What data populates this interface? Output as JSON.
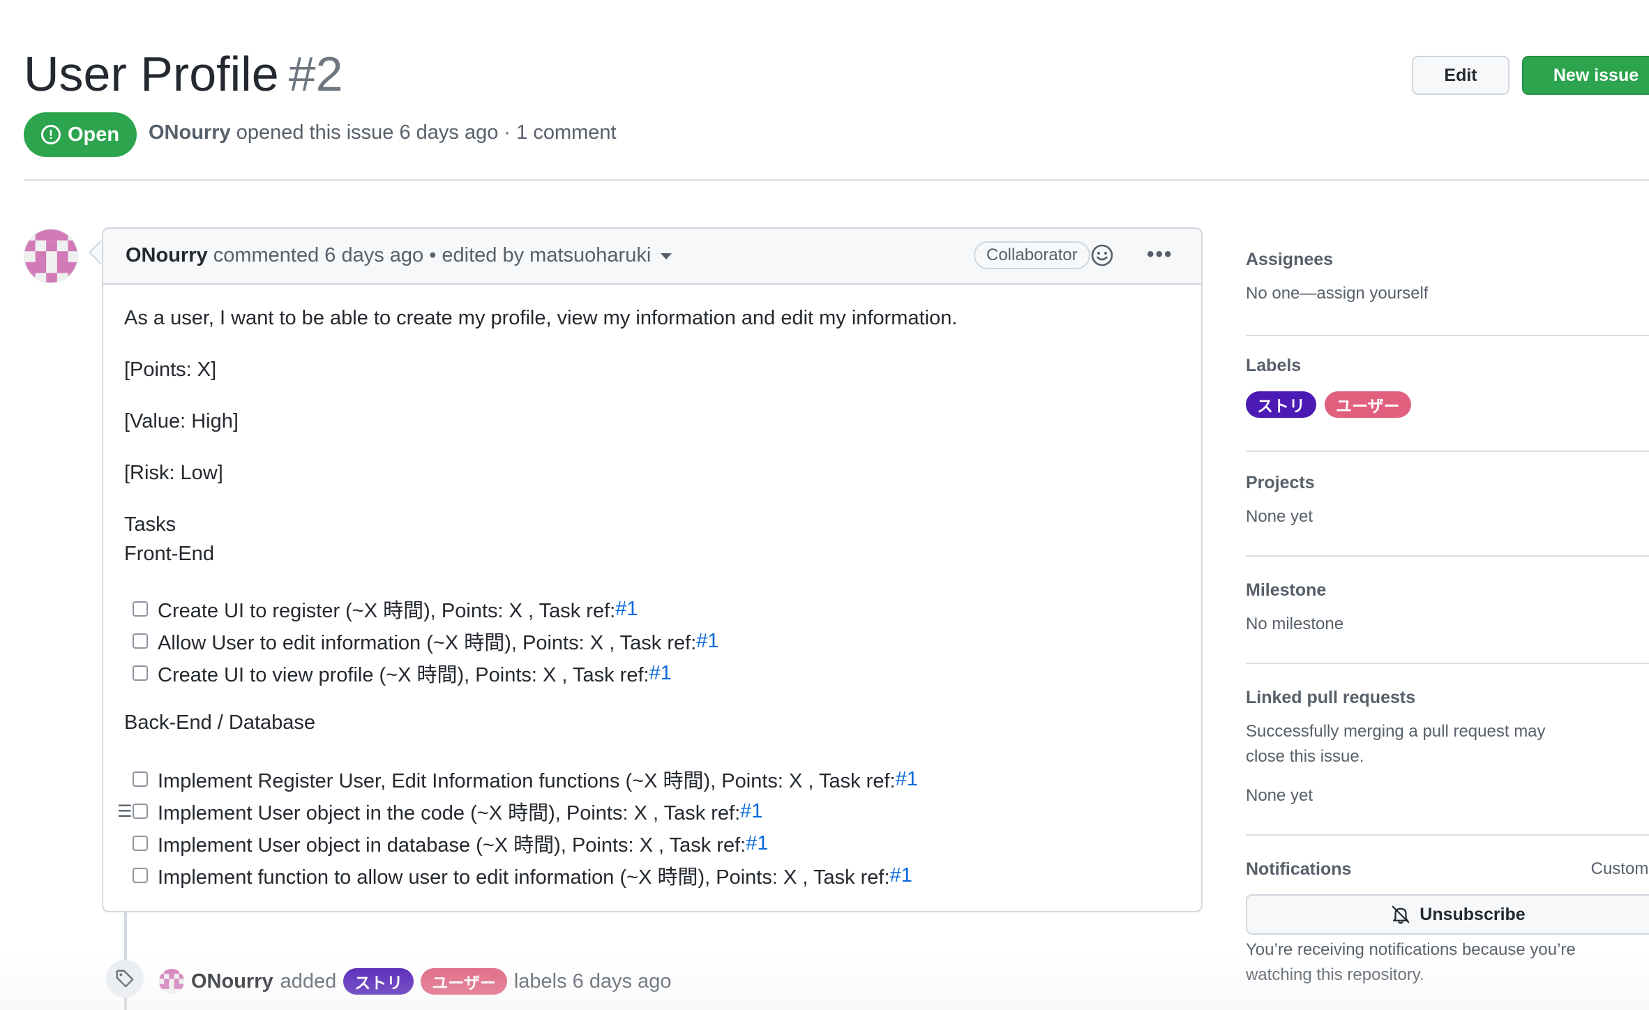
{
  "issue": {
    "title": "User Profile",
    "number": "#2",
    "state": "Open",
    "author": "ONourry",
    "meta_text": "opened this issue 6 days ago · 1 comment"
  },
  "header_buttons": {
    "edit": "Edit",
    "new_issue": "New issue"
  },
  "comment": {
    "author": "ONourry",
    "header_text": "commented 6 days ago • edited by matsuoharuki",
    "role_badge": "Collaborator",
    "body": {
      "intro": "As a user, I want to be able to create my profile, view my information and edit my information.",
      "points": "[Points: X]",
      "value": "[Value: High]",
      "risk": "[Risk: Low]",
      "tasks_heading": "Tasks",
      "frontend_heading": "Front-End",
      "frontend_tasks": [
        {
          "text": "Create UI to register (~X 時間), Points: X , Task ref: ",
          "ref": "#1"
        },
        {
          "text": "Allow User to edit information (~X 時間), Points: X , Task ref: ",
          "ref": "#1"
        },
        {
          "text": "Create UI to view profile (~X 時間), Points: X , Task ref: ",
          "ref": "#1"
        }
      ],
      "backend_heading": "Back-End / Database",
      "backend_tasks": [
        {
          "text": "Implement Register User, Edit Information functions (~X 時間), Points: X , Task ref: ",
          "ref": "#1"
        },
        {
          "text": "Implement User object in the code (~X 時間), Points: X , Task ref: ",
          "ref": "#1"
        },
        {
          "text": "Implement User object in database (~X 時間), Points: X , Task ref: ",
          "ref": "#1"
        },
        {
          "text": "Implement function to allow user to edit information (~X 時間), Points: X , Task ref: ",
          "ref": "#1"
        }
      ]
    }
  },
  "timeline_event": {
    "author": "ONourry",
    "action": "added",
    "labels": [
      "ストリ",
      "ユーザー"
    ],
    "suffix": "labels 6 days ago"
  },
  "sidebar": {
    "assignees": {
      "heading": "Assignees",
      "text": "No one—assign yourself"
    },
    "labels": {
      "heading": "Labels",
      "items": [
        {
          "name": "ストリ",
          "color": "#4c1ab5"
        },
        {
          "name": "ユーザー",
          "color": "#e0607e"
        }
      ]
    },
    "projects": {
      "heading": "Projects",
      "text": "None yet"
    },
    "milestone": {
      "heading": "Milestone",
      "text": "No milestone"
    },
    "linked_prs": {
      "heading": "Linked pull requests",
      "text1": "Successfully merging a pull request may",
      "text2": "close this issue.",
      "text3": "None yet"
    },
    "notifications": {
      "heading": "Notifications",
      "customize": "Customize",
      "button": "Unsubscribe",
      "text1": "You’re receiving notifications because you’re",
      "text2": "watching this repository."
    }
  },
  "colors": {
    "open_green": "#2da44e",
    "link_blue": "#0969da",
    "label_purple": "#4c1ab5",
    "label_pink": "#e0607e"
  }
}
